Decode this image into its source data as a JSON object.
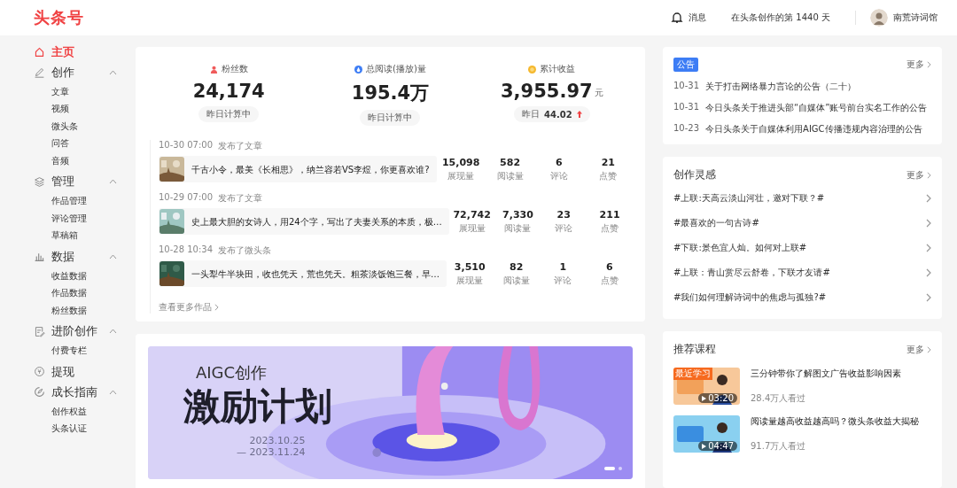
{
  "header": {
    "logo": "头条号",
    "messages": "消息",
    "days_text": "在头条创作的第 1440 天",
    "username": "南荒诗词馆"
  },
  "sidebar": {
    "items": [
      {
        "kind": "link",
        "label": "主页",
        "selected": true
      },
      {
        "kind": "group",
        "label": "创作",
        "selected": false,
        "expanded": true,
        "children": [
          {
            "label": "文章"
          },
          {
            "label": "视频"
          },
          {
            "label": "微头条"
          },
          {
            "label": "问答"
          },
          {
            "label": "音频"
          }
        ]
      },
      {
        "kind": "group",
        "label": "管理",
        "selected": false,
        "expanded": true,
        "children": [
          {
            "label": "作品管理"
          },
          {
            "label": "评论管理"
          },
          {
            "label": "草稿箱"
          }
        ]
      },
      {
        "kind": "group",
        "label": "数据",
        "selected": false,
        "expanded": true,
        "children": [
          {
            "label": "收益数据"
          },
          {
            "label": "作品数据"
          },
          {
            "label": "粉丝数据"
          }
        ]
      },
      {
        "kind": "group",
        "label": "进阶创作",
        "selected": false,
        "expanded": true,
        "children": [
          {
            "label": "付费专栏"
          }
        ]
      },
      {
        "kind": "link",
        "label": "提现",
        "selected": false
      },
      {
        "kind": "group",
        "label": "成长指南",
        "selected": false,
        "expanded": true,
        "children": [
          {
            "label": "创作权益"
          },
          {
            "label": "头条认证"
          }
        ]
      }
    ]
  },
  "stats": [
    {
      "label": "粉丝数",
      "value": "24,174",
      "note": "昨日计算中"
    },
    {
      "label": "总阅读(播放)量",
      "value": "195.4万",
      "note": "昨日计算中"
    },
    {
      "label": "累计收益",
      "value": "3,955.97",
      "unit": "元",
      "note": "昨日",
      "delta": "44.02"
    }
  ],
  "posts": [
    {
      "date": "10-30 07:00",
      "action": "发布了文章",
      "title": "千古小令，最美《长相思》，纳兰容若VS李煜，你更喜欢谁?",
      "metrics": [
        {
          "value": "15,098",
          "label": "展现量"
        },
        {
          "value": "582",
          "label": "阅读量"
        },
        {
          "value": "6",
          "label": "评论"
        },
        {
          "value": "21",
          "label": "点赞"
        }
      ]
    },
    {
      "date": "10-29 07:00",
      "action": "发布了文章",
      "title": "史上最大胆的女诗人，用24个字，写出了夫妻关系的本质，极…",
      "metrics": [
        {
          "value": "72,742",
          "label": "展现量"
        },
        {
          "value": "7,330",
          "label": "阅读量"
        },
        {
          "value": "23",
          "label": "评论"
        },
        {
          "value": "211",
          "label": "点赞"
        }
      ]
    },
    {
      "date": "10-28 10:34",
      "action": "发布了微头条",
      "title": "一头犁牛半块田，收也凭天，荒也凭天。粗茶淡饭饱三餐，早…",
      "metrics": [
        {
          "value": "3,510",
          "label": "展现量"
        },
        {
          "value": "82",
          "label": "阅读量"
        },
        {
          "value": "1",
          "label": "评论"
        },
        {
          "value": "6",
          "label": "点赞"
        }
      ]
    }
  ],
  "more_works": "查看更多作品",
  "banner": {
    "kind": "picture",
    "line1": "AIGC创作",
    "line2": "激励计划",
    "date_from": "2023.10.25",
    "date_to": "— 2023.11.24",
    "dots": [
      {
        "selected": true
      },
      {
        "selected": false
      }
    ]
  },
  "notices": {
    "tag": "公告",
    "more": "更多",
    "items": [
      {
        "date": "10-31",
        "text": "关于打击网络暴力言论的公告（二十）"
      },
      {
        "date": "10-31",
        "text": "今日头条关于推进头部“自媒体”账号前台实名工作的公告"
      },
      {
        "date": "10-23",
        "text": "今日头条关于自媒体利用AIGC传播违规内容治理的公告"
      }
    ]
  },
  "inspiration": {
    "title": "创作灵感",
    "more": "更多",
    "items": [
      "#上联:天高云淡山河壮，邀对下联？#",
      "#最喜欢的一句古诗#",
      "#下联:景色宜人灿。如何对上联#",
      "#上联：青山赏尽云舒卷，下联才友请#",
      "#我们如何理解诗词中的焦虑与孤独?#"
    ]
  },
  "courses": {
    "title": "推荐课程",
    "more": "更多",
    "items": [
      {
        "badge": "最近学习",
        "duration": "03:20",
        "title": "三分钟带你了解图文广告收益影响因素",
        "views": "28.4万人看过"
      },
      {
        "duration": "04:47",
        "title": "阅读量越高收益越高吗？微头条收益大揭秘",
        "views": "91.7万人看过"
      }
    ]
  }
}
